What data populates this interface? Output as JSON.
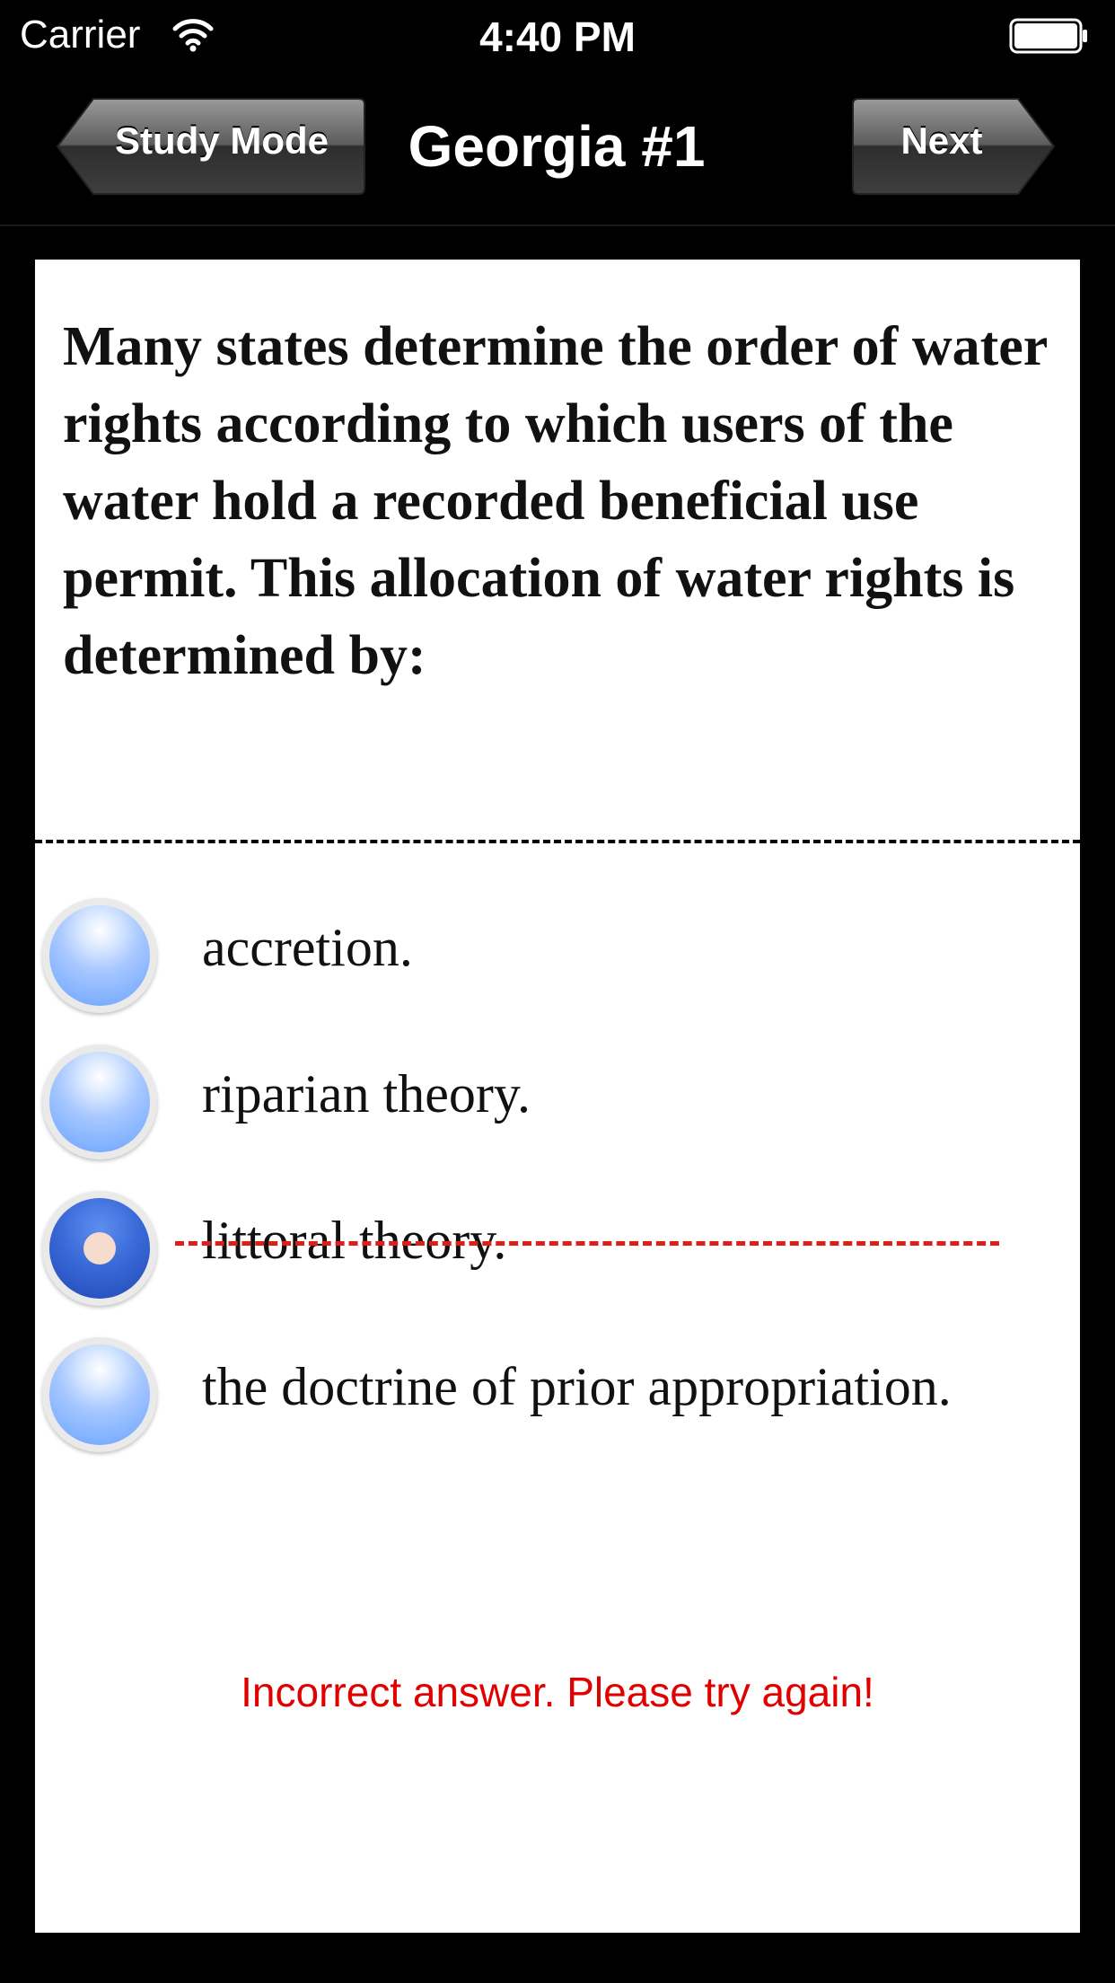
{
  "status_bar": {
    "carrier": "Carrier",
    "time": "4:40 PM"
  },
  "nav": {
    "back_label": "Study Mode",
    "title": "Georgia #1",
    "next_label": "Next"
  },
  "question": {
    "text": "Many states determine the order of water rights according to which users of the water hold a recorded beneficial use permit. This allocation of water rights is determined by:"
  },
  "answers": [
    {
      "label": "accretion.",
      "selected": false,
      "struck_out": false
    },
    {
      "label": "riparian theory.",
      "selected": false,
      "struck_out": false
    },
    {
      "label": "littoral theory.",
      "selected": true,
      "struck_out": true
    },
    {
      "label": "the doctrine of prior appropriation.",
      "selected": false,
      "struck_out": false
    }
  ],
  "feedback": {
    "message": "Incorrect answer. Please try again!",
    "color": "#e00000"
  }
}
